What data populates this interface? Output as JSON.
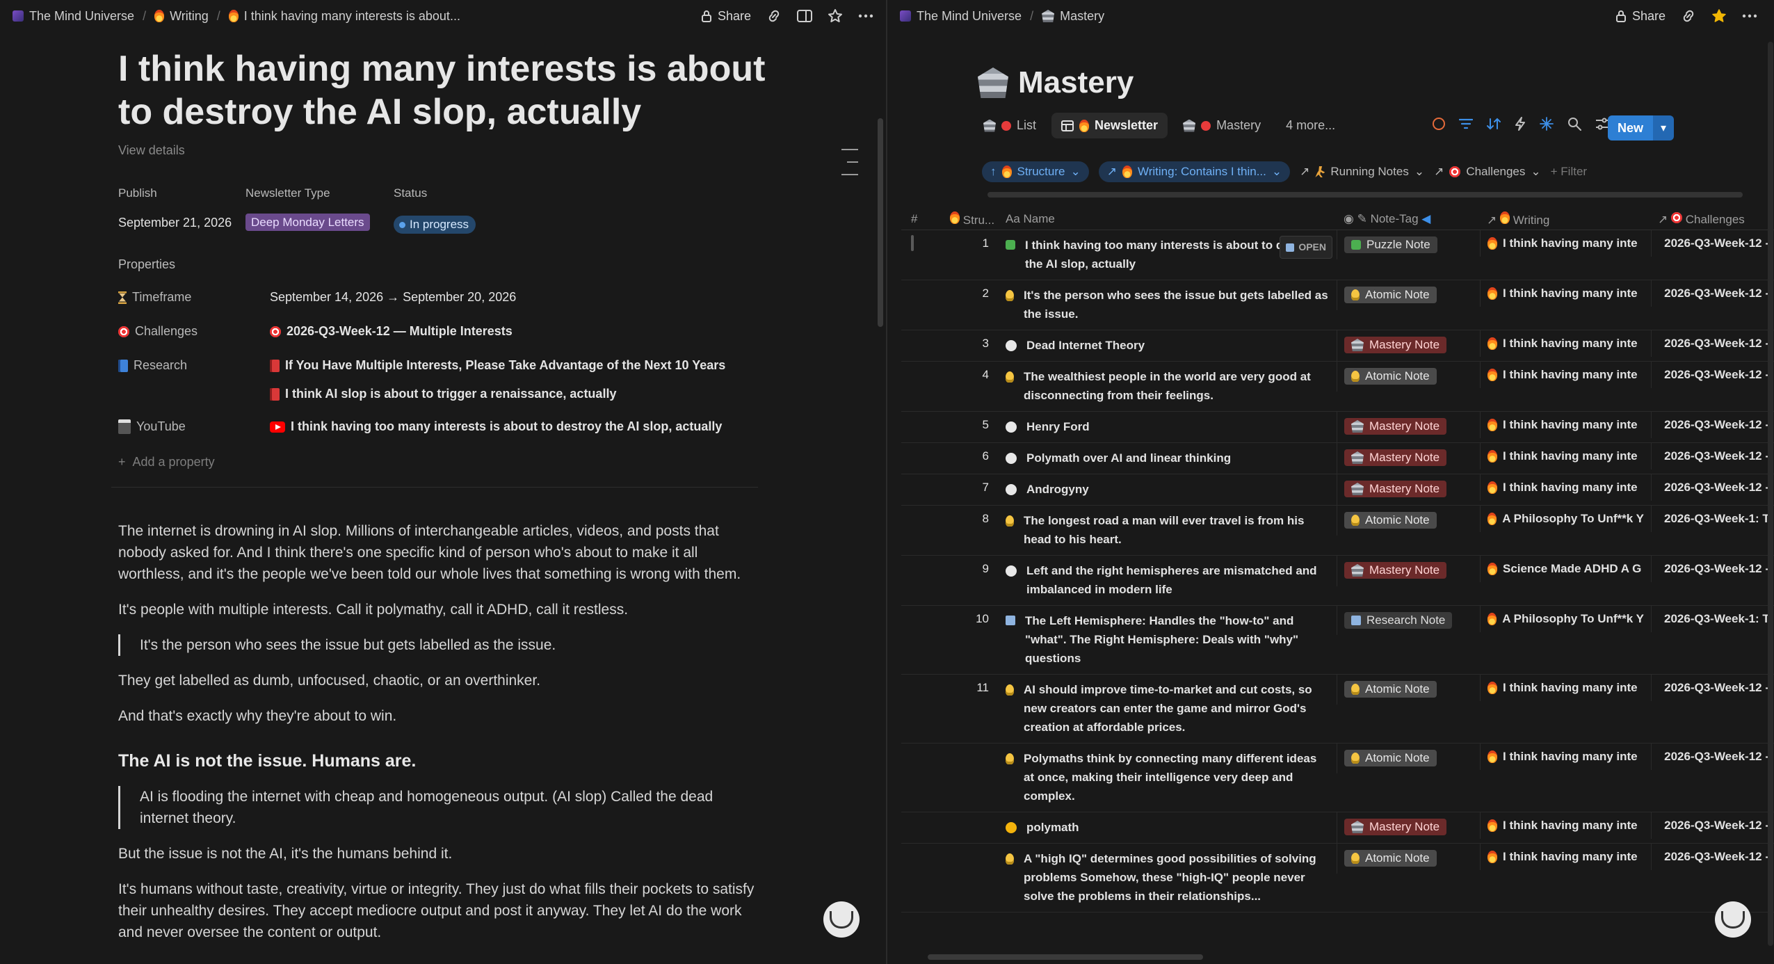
{
  "left": {
    "breadcrumbs": [
      "The Mind Universe",
      "Writing",
      "I think having many interests is about..."
    ],
    "share_label": "Share",
    "title": "I think having many interests is about to destroy the AI slop, actually",
    "view_details": "View details",
    "props_header": {
      "publish_label": "Publish",
      "publish_value": "September 21, 2026",
      "type_label": "Newsletter Type",
      "type_value": "Deep Monday Letters",
      "status_label": "Status",
      "status_value": "In progress"
    },
    "properties_label": "Properties",
    "timeframe_label": "Timeframe",
    "timeframe_value": "September 14, 2026 → September 20, 2026",
    "challenges_label": "Challenges",
    "challenges_value": "2026-Q3-Week-12 — Multiple Interests",
    "research_label": "Research",
    "research_values": [
      "If You Have Multiple Interests, Please Take Advantage of the Next 10 Years",
      "I think AI slop is about to trigger a renaissance, actually"
    ],
    "youtube_label": "YouTube",
    "youtube_value": "I think having too many interests is about to destroy the AI slop, actually",
    "add_property": "Add a property",
    "body": {
      "p1": "The internet is drowning in AI slop. Millions of interchangeable articles, videos, and posts that nobody asked for. And I think there's one specific kind of person who's about to make it all worthless, and it's the people we've been told our whole lives that something is wrong with them.",
      "p2": "It's people with multiple interests. Call it polymathy, call it ADHD, call it restless.",
      "q1": "It's the person who sees the issue but gets labelled as the issue.",
      "p3": "They get labelled as dumb, unfocused, chaotic, or an overthinker.",
      "p4": "And that's exactly why they're about to win.",
      "h2": "The AI is not the issue. Humans are.",
      "q2": "AI is flooding the internet with cheap and homogeneous output. (AI slop) Called the dead internet theory.",
      "p5": "But the issue is not the AI,  it's the humans behind it.",
      "p6": "It's humans without taste, creativity, virtue or integrity. They just do what fills their pockets to satisfy their unhealthy desires. They accept mediocre output and post it anyway. They let AI do the work and never oversee the content or output."
    }
  },
  "right": {
    "breadcrumbs": [
      "The Mind Universe",
      "Mastery"
    ],
    "share_label": "Share",
    "title": "Mastery",
    "views": [
      "List",
      "Newsletter",
      "Mastery",
      "4 more..."
    ],
    "new_label": "New",
    "filters": {
      "structure": "Structure",
      "writing": "Writing: Contains I thin...",
      "running": "Running Notes",
      "challenges": "Challenges",
      "add": "+ Filter"
    },
    "columns": [
      "#",
      "Stru...",
      "Name",
      "Note-Tag",
      "Writing",
      "Challenges"
    ],
    "open_label": "OPEN",
    "rows": [
      {
        "num": "1",
        "icon": "puzzle",
        "name": "I think having too many interests is about to destroy the AI slop, actually",
        "tag": "Puzzle Note",
        "tagtype": "puzzle",
        "writing": "I think having many inte",
        "challenge": "2026-Q3-Week-12 -"
      },
      {
        "num": "2",
        "icon": "bulb",
        "name": "It's the person who sees the issue but gets labelled as the issue.",
        "tag": "Atomic Note",
        "tagtype": "atomic",
        "writing": "I think having many inte",
        "challenge": "2026-Q3-Week-12 -"
      },
      {
        "num": "3",
        "icon": "dot",
        "name": "Dead Internet Theory",
        "tag": "Mastery Note",
        "tagtype": "mastery",
        "writing": "I think having many inte",
        "challenge": "2026-Q3-Week-12 -"
      },
      {
        "num": "4",
        "icon": "bulb",
        "name": "The wealthiest people in the world are very good at disconnecting from their feelings.",
        "tag": "Atomic Note",
        "tagtype": "atomic",
        "writing": "I think having many inte",
        "challenge": "2026-Q3-Week-12 -"
      },
      {
        "num": "5",
        "icon": "dot",
        "name": "Henry Ford",
        "tag": "Mastery Note",
        "tagtype": "mastery",
        "writing": "I think having many inte",
        "challenge": "2026-Q3-Week-12 -"
      },
      {
        "num": "6",
        "icon": "dot",
        "name": "Polymath over AI and linear thinking",
        "tag": "Mastery Note",
        "tagtype": "mastery",
        "writing": "I think having many inte",
        "challenge": "2026-Q3-Week-12 -"
      },
      {
        "num": "7",
        "icon": "dot",
        "name": "Androgyny",
        "tag": "Mastery Note",
        "tagtype": "mastery",
        "writing": "I think having many inte",
        "challenge": "2026-Q3-Week-12 -"
      },
      {
        "num": "8",
        "icon": "bulb",
        "name": "The longest road a man will ever travel is from his head to his heart.",
        "tag": "Atomic Note",
        "tagtype": "atomic",
        "writing": "A Philosophy To Unf**k Y",
        "challenge": "2026-Q3-Week-1: T"
      },
      {
        "num": "9",
        "icon": "dot",
        "name": "Left and the right hemispheres are mismatched and imbalanced in modern life",
        "tag": "Mastery Note",
        "tagtype": "mastery",
        "writing": "Science Made ADHD A G",
        "challenge": "2026-Q3-Week-12 -"
      },
      {
        "num": "10",
        "icon": "book",
        "name": "The Left Hemisphere: Handles the \"how-to\" and \"what\". The Right Hemisphere: Deals with \"why\" questions",
        "tag": "Research Note",
        "tagtype": "research",
        "writing": "A Philosophy To Unf**k Y",
        "challenge": "2026-Q3-Week-1: T"
      },
      {
        "num": "11",
        "icon": "bulb",
        "name": "AI should improve time-to-market and cut costs, so new creators can enter the game and mirror God's creation at affordable prices.",
        "tag": "Atomic Note",
        "tagtype": "atomic",
        "writing": "I think having many inte",
        "challenge": "2026-Q3-Week-12 -"
      },
      {
        "num": "",
        "icon": "bulb",
        "name": "Polymaths think by connecting many different ideas at once, making their intelligence very deep and complex.",
        "tag": "Atomic Note",
        "tagtype": "atomic",
        "writing": "I think having many inte",
        "challenge": "2026-Q3-Week-12 -"
      },
      {
        "num": "",
        "icon": "ydot",
        "name": "polymath",
        "tag": "Mastery Note",
        "tagtype": "mastery",
        "writing": "I think having many inte",
        "challenge": "2026-Q3-Week-12 -"
      },
      {
        "num": "",
        "icon": "bulb",
        "name": "A \"high IQ\" determines good possibilities of solving problems Somehow, these \"high-IQ\" people never solve the problems in their relationships...",
        "tag": "Atomic Note",
        "tagtype": "atomic",
        "writing": "I think having many inte",
        "challenge": "2026-Q3-Week-12 -"
      }
    ]
  }
}
